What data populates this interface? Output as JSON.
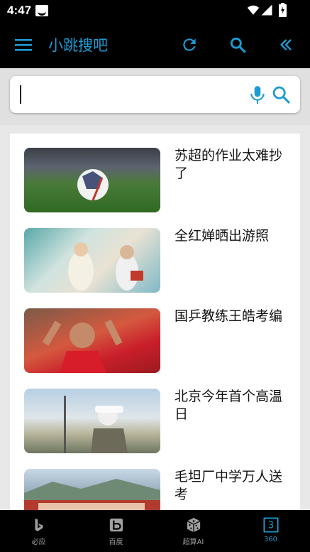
{
  "status_bar": {
    "time": "4:47"
  },
  "app_bar": {
    "title": "小跳搜吧",
    "menu_icon": "menu-icon",
    "refresh_icon": "refresh-icon",
    "search_icon": "search-icon",
    "collapse_icon": "double-chevron-left-icon"
  },
  "search": {
    "value": "",
    "placeholder": ""
  },
  "news": [
    {
      "title": "苏超的作业太难抄了",
      "thumb": "soccer-ball-stadium"
    },
    {
      "title": "全红婵晒出游照",
      "thumb": "people-photo"
    },
    {
      "title": "国乒教练王皓考编",
      "thumb": "coach-photo"
    },
    {
      "title": "北京今年首个高温日",
      "thumb": "street-photo"
    },
    {
      "title": "毛坦厂中学万人送考",
      "thumb": "town-photo"
    }
  ],
  "bottom_nav": [
    {
      "label": "必应",
      "icon": "bing-icon",
      "active": false
    },
    {
      "label": "百度",
      "icon": "baidu-icon",
      "active": false
    },
    {
      "label": "超算AI",
      "icon": "dice-icon",
      "active": false
    },
    {
      "label": "360",
      "icon": "360-icon",
      "active": true
    }
  ],
  "colors": {
    "accent": "#1e9bd2",
    "bar_bg": "#000000",
    "page_bg": "#e8e8e8"
  }
}
